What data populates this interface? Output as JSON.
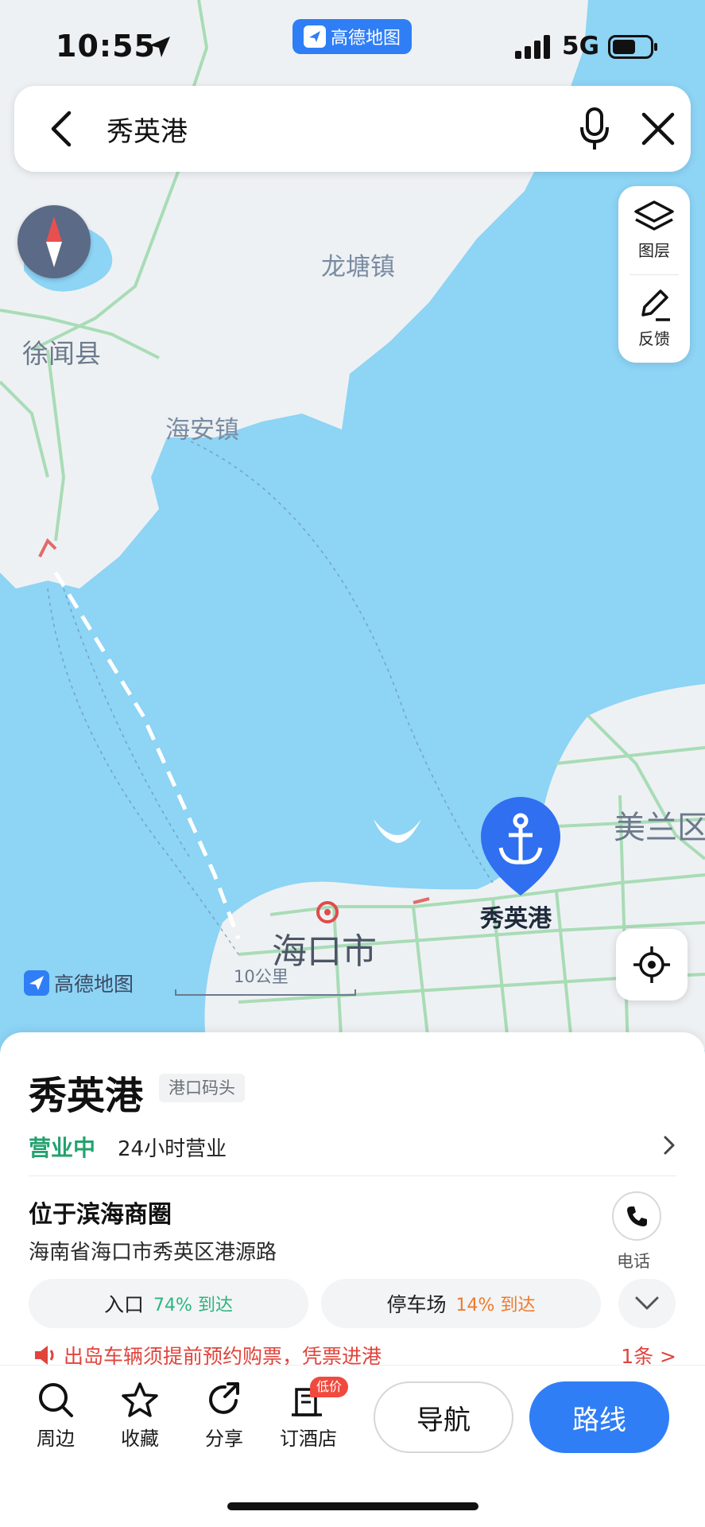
{
  "status_bar": {
    "time": "10:55",
    "network": "5G",
    "app_badge": "高德地图"
  },
  "search": {
    "query": "秀英港"
  },
  "map_tools": {
    "layers_label": "图层",
    "feedback_label": "反馈"
  },
  "map_labels": {
    "longtang": "龙塘镇",
    "xuwen": "徐闻县",
    "haian": "海安镇",
    "haikou": "海口市",
    "meilan": "美兰区",
    "poi": "秀英港"
  },
  "map_meta": {
    "watermark": "高德地图",
    "scale": "10公里"
  },
  "place": {
    "title": "秀英港",
    "category": "港口码头",
    "status": "营业中",
    "hours": "24小时营业",
    "area": "位于滨海商圈",
    "address": "海南省海口市秀英区港源路",
    "call_label": "电话"
  },
  "chips": {
    "entrance": {
      "label": "入口",
      "pct": "74% 到达"
    },
    "parking": {
      "label": "停车场",
      "pct": "14% 到达"
    }
  },
  "notice": {
    "text": "出岛车辆须提前预约购票，凭票进港",
    "count": "1条 >"
  },
  "tabs": {
    "nearby": "周边",
    "favorite": "收藏",
    "share": "分享",
    "hotel": "订酒店",
    "hotel_badge": "低价",
    "navigate": "导航",
    "route": "路线"
  },
  "colors": {
    "accent": "#2f7ef6",
    "open_green": "#23a26e",
    "sea": "#8dd4f5",
    "land": "#eef1f3",
    "road": "#a8dcb6"
  }
}
